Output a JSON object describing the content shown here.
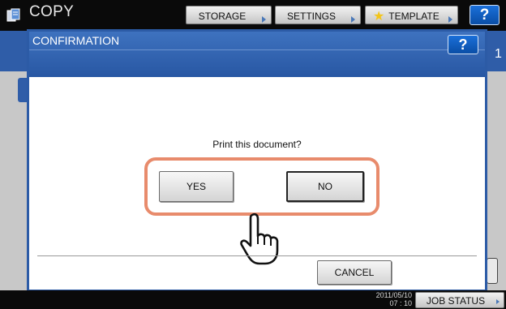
{
  "header": {
    "app_icon": "copy-icon",
    "title": "COPY",
    "storage_label": "STORAGE",
    "settings_label": "SETTINGS",
    "template_label": "TEMPLATE",
    "help_label": "?"
  },
  "background": {
    "page_number": "1"
  },
  "dialog": {
    "title": "CONFIRMATION",
    "help_label": "?",
    "message": "Print this document?",
    "yes_label": "YES",
    "no_label": "NO",
    "cancel_label": "CANCEL",
    "pointer_icon": "hand-pointer-icon"
  },
  "status": {
    "date": "2011/05/10",
    "time": "07 : 10",
    "job_status_label": "JOB STATUS"
  },
  "colors": {
    "accent_blue": "#2c5ba6",
    "highlight": "#e88b6c"
  }
}
